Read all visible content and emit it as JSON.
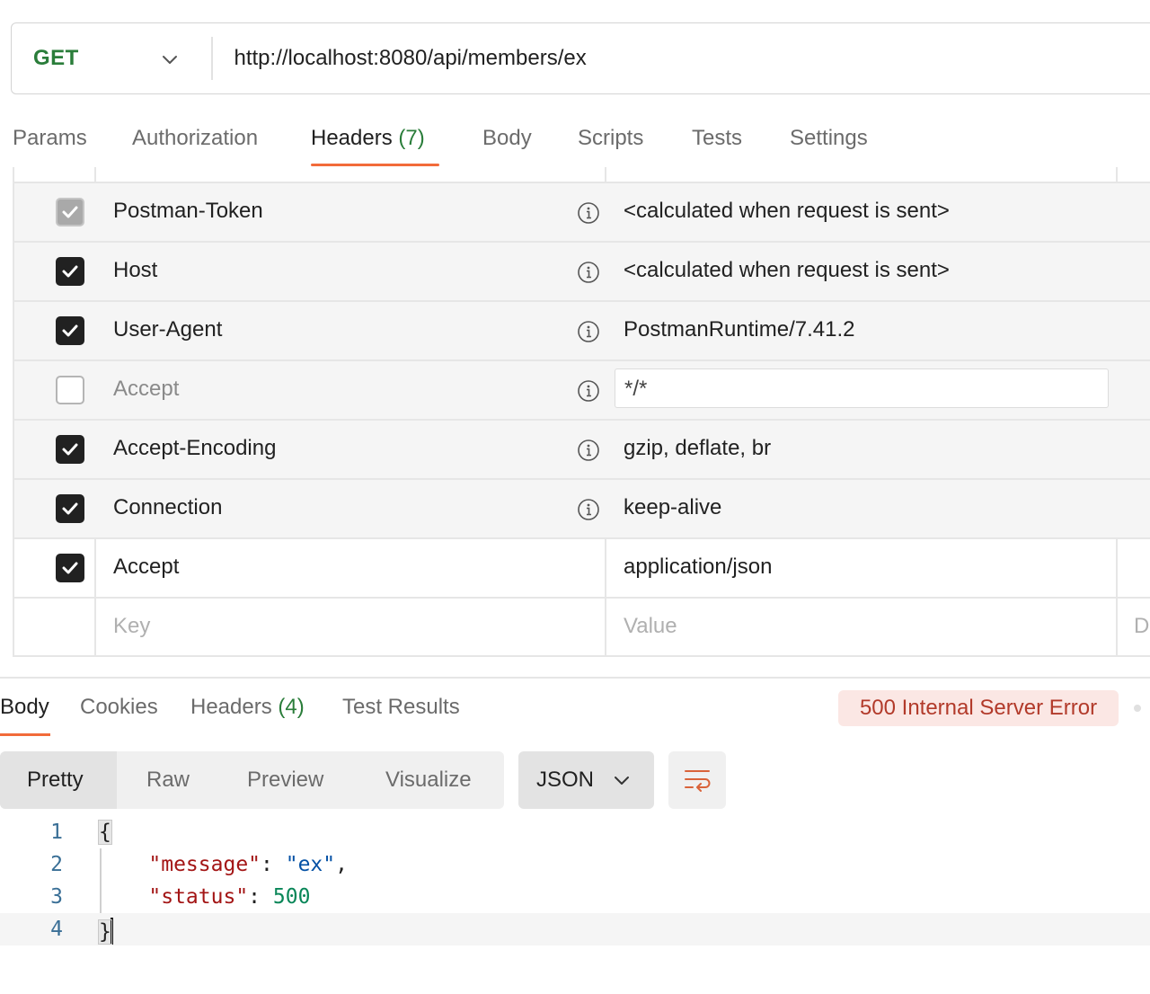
{
  "request": {
    "method": "GET",
    "url": "http://localhost:8080/api/members/ex"
  },
  "request_tabs": [
    {
      "label": "Params"
    },
    {
      "label": "Authorization"
    },
    {
      "label": "Headers",
      "count": "(7)",
      "active": true
    },
    {
      "label": "Body"
    },
    {
      "label": "Scripts"
    },
    {
      "label": "Tests"
    },
    {
      "label": "Settings"
    }
  ],
  "headers_table": {
    "rows": [
      {
        "checked": "grey",
        "key": "Postman-Token",
        "value": "<calculated when request is sent>",
        "info": true
      },
      {
        "checked": "on",
        "key": "Host",
        "value": "<calculated when request is sent>",
        "info": true
      },
      {
        "checked": "on",
        "key": "User-Agent",
        "value": "PostmanRuntime/7.41.2",
        "info": true
      },
      {
        "checked": "off",
        "key": "Accept",
        "value": "*/*",
        "info": true
      },
      {
        "checked": "on",
        "key": "Accept-Encoding",
        "value": "gzip, deflate, br",
        "info": true
      },
      {
        "checked": "on",
        "key": "Connection",
        "value": "keep-alive",
        "info": true
      },
      {
        "checked": "on",
        "key": "Accept",
        "value": "application/json",
        "info": false
      }
    ],
    "placeholder_key": "Key",
    "placeholder_value": "Value",
    "placeholder_desc": "De"
  },
  "response_tabs": [
    {
      "label": "Body",
      "active": true
    },
    {
      "label": "Cookies"
    },
    {
      "label": "Headers",
      "count": "(4)"
    },
    {
      "label": "Test Results"
    }
  ],
  "status": "500 Internal Server Error",
  "body_views": [
    "Pretty",
    "Raw",
    "Preview",
    "Visualize"
  ],
  "format": "JSON",
  "code_lines": [
    {
      "num": "1",
      "text": "{"
    },
    {
      "num": "2",
      "key": "\"message\"",
      "value": "\"ex\""
    },
    {
      "num": "3",
      "key": "\"status\"",
      "value": "500"
    },
    {
      "num": "4",
      "text": "}"
    }
  ],
  "colors": {
    "accent": "#f26b3a",
    "method_green": "#2a7d3a",
    "error_bg": "#fbe7e4",
    "error_text": "#b23a2a"
  }
}
